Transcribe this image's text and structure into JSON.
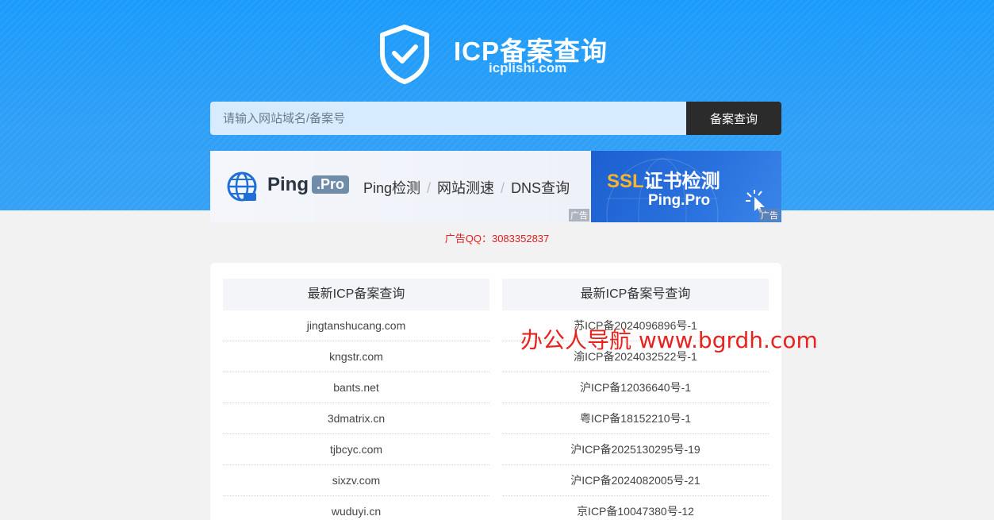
{
  "header": {
    "title": "ICP备案查询",
    "subtitle": "icplishi.com"
  },
  "search": {
    "placeholder": "请输入网站域名/备案号",
    "button_label": "备案查询"
  },
  "ads": {
    "left": {
      "brand": "Ping",
      "brand_suffix": ".Pro",
      "links": [
        "Ping检测",
        "网站测速",
        "DNS查询"
      ],
      "tag": "广告"
    },
    "right": {
      "title_accent": "SSL",
      "title_rest": "证书检测",
      "subtitle": "Ping.Pro",
      "tag": "广告"
    },
    "contact": "广告QQ：3083352837"
  },
  "lists": {
    "left": {
      "header": "最新ICP备案查询",
      "items": [
        "jingtanshucang.com",
        "kngstr.com",
        "bants.net",
        "3dmatrix.cn",
        "tjbcyc.com",
        "sixzv.com",
        "wuduyi.cn"
      ]
    },
    "right": {
      "header": "最新ICP备案号查询",
      "items": [
        "苏ICP备2024096896号-1",
        "渝ICP备2024032522号-1",
        "沪ICP备12036640号-1",
        "粤ICP备18152210号-1",
        "沪ICP备2025130295号-19",
        "沪ICP备2024082005号-21",
        "京ICP备10047380号-12"
      ]
    }
  },
  "watermark": "办公人导航  www.bgrdh.com",
  "colors": {
    "hero_blue": "#1a9bfc",
    "search_button": "#2b2b2b",
    "ad_contact": "#e02020",
    "ssl_accent": "#f6b52a",
    "watermark": "#e8231f"
  }
}
